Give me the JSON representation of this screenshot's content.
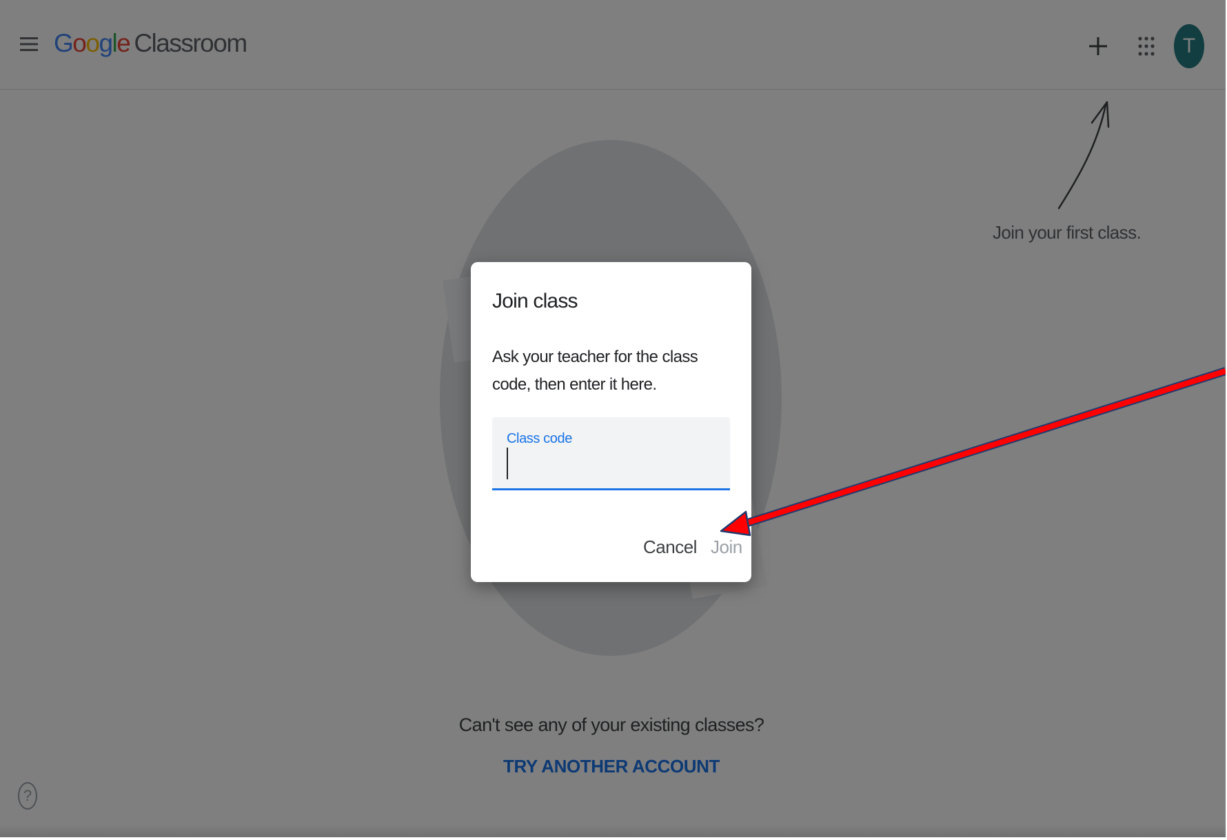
{
  "header": {
    "logo": {
      "google_letters": [
        "G",
        "o",
        "o",
        "g",
        "l",
        "e"
      ],
      "product": "Classroom"
    },
    "avatar_initial": "T",
    "icons": {
      "menu": "hamburger-menu-icon",
      "add": "plus-icon",
      "apps": "google-apps-grid-icon"
    }
  },
  "main": {
    "callout": "Join your first class.",
    "cant_see": "Can't see any of your existing classes?",
    "try_another": "TRY ANOTHER ACCOUNT",
    "help_icon": "?"
  },
  "dialog": {
    "title": "Join class",
    "body": "Ask your teacher for the class code, then enter it here.",
    "field_label": "Class code",
    "field_value": "",
    "cancel_label": "Cancel",
    "join_label": "Join"
  },
  "colors": {
    "google_blue": "#4285f4",
    "google_red": "#ea4335",
    "google_yellow": "#fbbc05",
    "google_green": "#34a853",
    "accent_blue": "#1a73e8",
    "avatar_teal": "#257c82",
    "annotation_red": "#ff0000"
  }
}
